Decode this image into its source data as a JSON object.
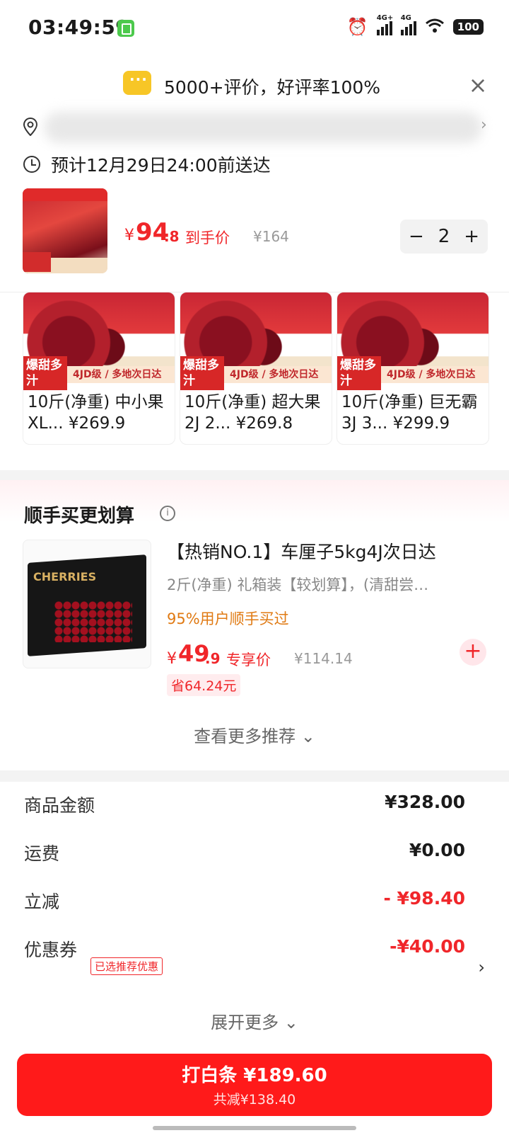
{
  "status": {
    "time": "03:49:59",
    "battery": "100",
    "net1": "4G+",
    "net2": "4G"
  },
  "review": {
    "text": "5000+评价，好评率100%"
  },
  "delivery": {
    "text": "预计12月29日24:00前送达"
  },
  "product": {
    "price_symbol": "¥",
    "price_int": "94",
    "price_dec": ".8",
    "price_label": "到手价",
    "original_price": "¥164",
    "quantity": "2",
    "minus": "−",
    "plus": "+"
  },
  "variants": [
    {
      "badge": "爆甜多汁",
      "stripe": "4JD级 / 多地次日达",
      "name": "10斤(净重) 中小果",
      "sub": "XL...  ¥269.9"
    },
    {
      "badge": "爆甜多汁",
      "stripe": "4JD级 / 多地次日达",
      "name": "10斤(净重) 超大果",
      "sub": "2J 2...  ¥269.8"
    },
    {
      "badge": "爆甜多汁",
      "stripe": "4JD级 / 多地次日达",
      "name": "10斤(净重) 巨无霸",
      "sub": "3J 3...  ¥299.9"
    }
  ],
  "recommend": {
    "title": "顺手买更划算",
    "image_logo": "CHERRIES",
    "name": "【热销NO.1】车厘子5kg4J次日达",
    "desc": "2斤(净重) 礼箱装【较划算】，(清甜尝…",
    "bought": "95%用户顺手买过",
    "price_symbol": "¥",
    "price_int": "49",
    "price_dec": ".9",
    "price_label": "专享价",
    "original_price": "¥114.14",
    "save": "省64.24元",
    "more": "查看更多推荐 ⌄"
  },
  "summary": {
    "rows": [
      {
        "label": "商品金额",
        "value": "¥328.00"
      },
      {
        "label": "运费",
        "value": "¥0.00"
      },
      {
        "label": "立减",
        "value": "- ¥98.40"
      },
      {
        "label": "优惠券",
        "value": "-¥40.00"
      }
    ],
    "coupon_tag": "已选推荐优惠",
    "expand": "展开更多 ⌄"
  },
  "pay": {
    "main": "打白条 ¥189.60",
    "sub": "共减¥138.40"
  },
  "colors": {
    "accent": "#f0262a",
    "button": "#ff1a1a",
    "highlight": "#e07a13"
  }
}
